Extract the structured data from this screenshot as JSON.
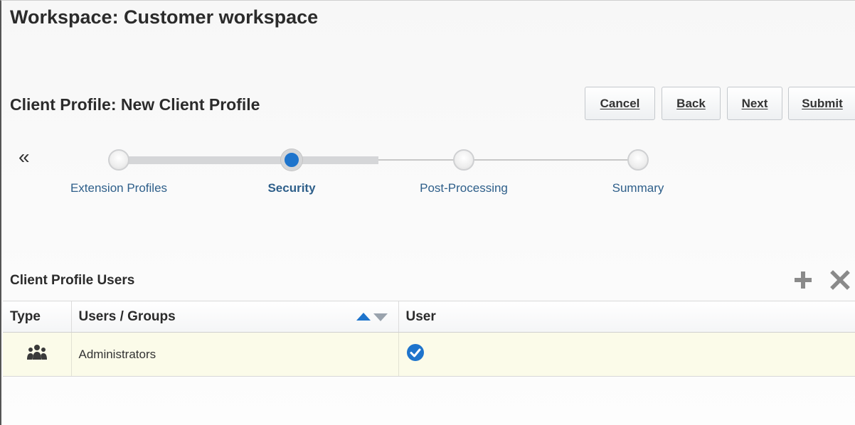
{
  "workspace": {
    "title": "Workspace: Customer workspace"
  },
  "profile": {
    "title": "Client Profile: New Client Profile"
  },
  "toolbar": {
    "cancel_label": "Cancel",
    "back_label": "Back",
    "next_label": "Next",
    "submit_label": "Submit"
  },
  "train": {
    "collapse_glyph": "«",
    "steps": [
      {
        "label": "Extension Profiles",
        "state": "visited"
      },
      {
        "label": "Security",
        "state": "current"
      },
      {
        "label": "Post-Processing",
        "state": "unvisited"
      },
      {
        "label": "Summary",
        "state": "unvisited"
      }
    ]
  },
  "users_section": {
    "title": "Client Profile Users",
    "add_icon": "plus-icon",
    "delete_icon": "close-icon",
    "columns": [
      "Type",
      "Users / Groups",
      "User"
    ],
    "rows": [
      {
        "type_icon": "group-icon",
        "name": "Administrators",
        "user_checked": true
      }
    ]
  },
  "colors": {
    "accent": "#1e74cc",
    "link": "#2e5f8a",
    "selected_row": "#fbfbe9",
    "icon_gray": "#888888"
  }
}
